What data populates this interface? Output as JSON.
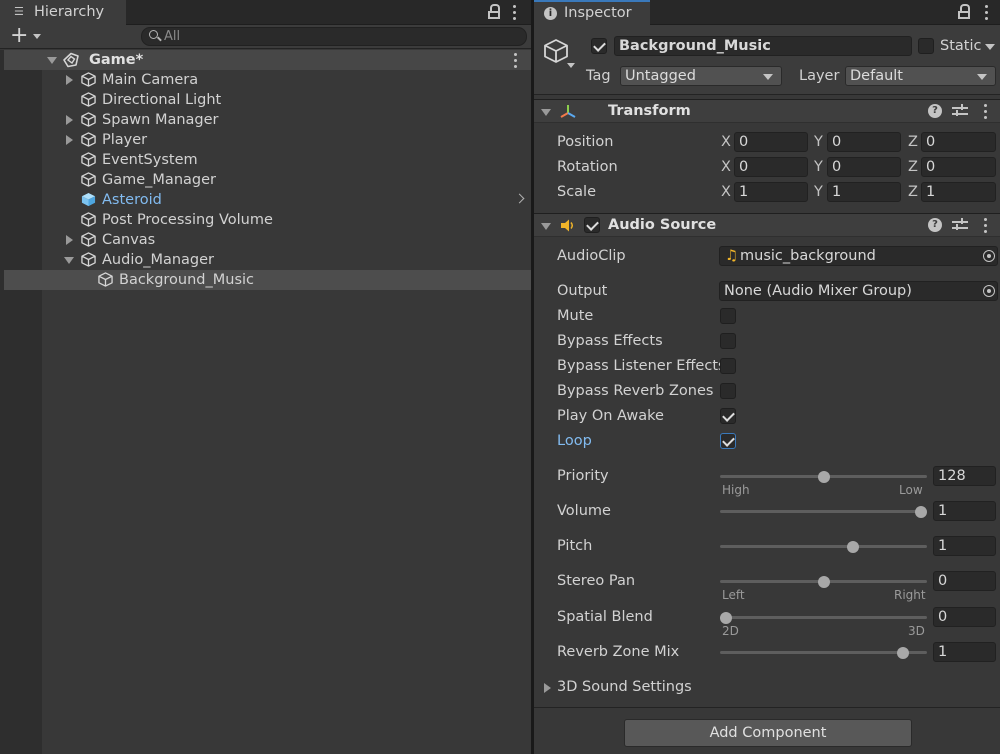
{
  "hierarchy": {
    "tab_label": "Hierarchy",
    "search_placeholder": "All",
    "scene_name": "Game*",
    "items": [
      {
        "label": "Main Camera"
      },
      {
        "label": "Directional Light"
      },
      {
        "label": "Spawn Manager"
      },
      {
        "label": "Player"
      },
      {
        "label": "EventSystem"
      },
      {
        "label": "Game_Manager"
      },
      {
        "label": "Asteroid"
      },
      {
        "label": "Post Processing Volume"
      },
      {
        "label": "Canvas"
      },
      {
        "label": "Audio_Manager"
      },
      {
        "label": "Background_Music"
      }
    ]
  },
  "inspector": {
    "tab_label": "Inspector",
    "object_name": "Background_Music",
    "static_label": "Static",
    "tag_label": "Tag",
    "tag_value": "Untagged",
    "layer_label": "Layer",
    "layer_value": "Default",
    "transform": {
      "title": "Transform",
      "rows": [
        {
          "label": "Position",
          "x": "0",
          "y": "0",
          "z": "0"
        },
        {
          "label": "Rotation",
          "x": "0",
          "y": "0",
          "z": "0"
        },
        {
          "label": "Scale",
          "x": "1",
          "y": "1",
          "z": "1"
        }
      ],
      "axis_x": "X",
      "axis_y": "Y",
      "axis_z": "Z"
    },
    "audio_source": {
      "title": "Audio Source",
      "audio_clip_label": "AudioClip",
      "audio_clip_value": "music_background",
      "output_label": "Output",
      "output_value": "None (Audio Mixer Group)",
      "toggles": [
        {
          "label": "Mute",
          "checked": false
        },
        {
          "label": "Bypass Effects",
          "checked": false
        },
        {
          "label": "Bypass Listener Effects",
          "checked": false
        },
        {
          "label": "Bypass Reverb Zones",
          "checked": false
        },
        {
          "label": "Play On Awake",
          "checked": true
        },
        {
          "label": "Loop",
          "checked": true
        }
      ],
      "sliders": {
        "priority": {
          "label": "Priority",
          "value": "128",
          "fraction": 0.5,
          "min_label": "High",
          "max_label": "Low"
        },
        "volume": {
          "label": "Volume",
          "value": "1",
          "fraction": 1.0
        },
        "pitch": {
          "label": "Pitch",
          "value": "1",
          "fraction": 0.65
        },
        "stereo_pan": {
          "label": "Stereo Pan",
          "value": "0",
          "fraction": 0.5,
          "min_label": "Left",
          "max_label": "Right"
        },
        "spatial_blend": {
          "label": "Spatial Blend",
          "value": "0",
          "fraction": 0.0,
          "min_label": "2D",
          "max_label": "3D"
        },
        "reverb_zone_mix": {
          "label": "Reverb Zone Mix",
          "value": "1",
          "fraction": 0.91
        }
      },
      "sound_settings_label": "3D Sound Settings"
    },
    "add_component_label": "Add Component"
  },
  "colors": {
    "accent_blue": "#3a79bb",
    "link_blue": "#82bbf0",
    "cube_blue": "#7cc4f2",
    "panel_bg": "#383838"
  }
}
